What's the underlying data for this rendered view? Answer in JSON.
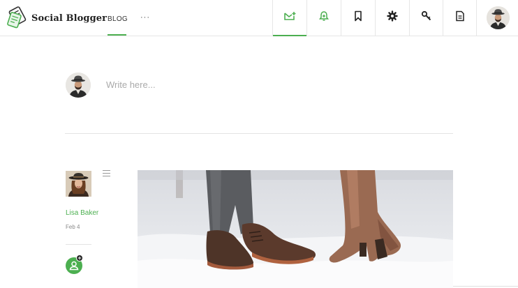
{
  "header": {
    "brand": "Social Blogger",
    "nav": {
      "blog_label": "BLOG",
      "more_label": "···"
    },
    "icons": [
      "mail-icon",
      "bell-icon",
      "bookmark-icon",
      "gear-icon",
      "key-icon",
      "document-icon"
    ],
    "active_icon": "mail-icon",
    "accent_color": "#4caf50"
  },
  "composer": {
    "placeholder": "Write here..."
  },
  "post": {
    "author": "Lisa Baker",
    "date": "Feb 4"
  }
}
